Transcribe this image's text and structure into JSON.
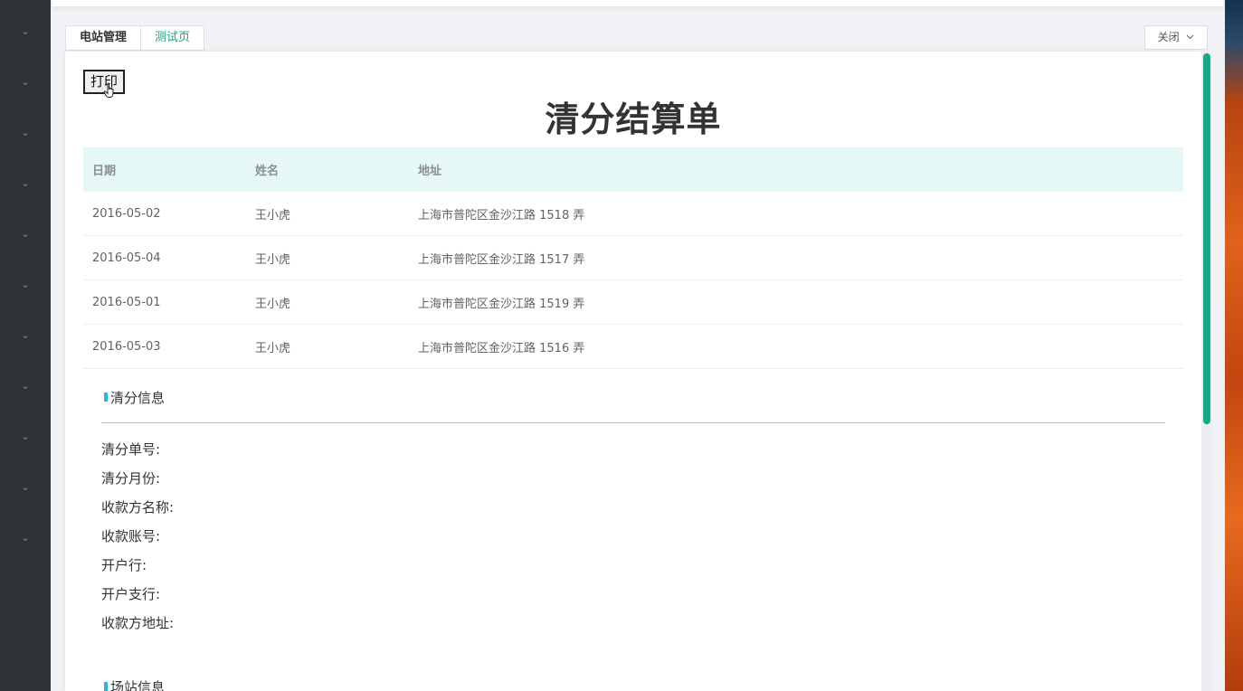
{
  "sidebar": {
    "chevron_glyph": "⌄",
    "items": [
      {
        "icon": "chevron-down-icon"
      },
      {
        "icon": "chevron-down-icon"
      },
      {
        "icon": "chevron-down-icon"
      },
      {
        "icon": "chevron-down-icon"
      },
      {
        "icon": "chevron-down-icon"
      },
      {
        "icon": "chevron-down-icon"
      },
      {
        "icon": "chevron-down-icon"
      },
      {
        "icon": "chevron-down-icon"
      },
      {
        "icon": "chevron-down-icon"
      },
      {
        "icon": "chevron-down-icon"
      },
      {
        "icon": "chevron-down-icon"
      }
    ]
  },
  "tabs": [
    {
      "label": "电站管理",
      "active": false
    },
    {
      "label": "测试页",
      "active": true
    }
  ],
  "close_button": {
    "label": "关闭",
    "icon": "chevron-down-icon"
  },
  "print_button": {
    "label": "打印"
  },
  "document": {
    "title": "清分结算单",
    "table": {
      "headers": [
        "日期",
        "姓名",
        "地址"
      ],
      "rows": [
        [
          "2016-05-02",
          "王小虎",
          "上海市普陀区金沙江路 1518 弄"
        ],
        [
          "2016-05-04",
          "王小虎",
          "上海市普陀区金沙江路 1517 弄"
        ],
        [
          "2016-05-01",
          "王小虎",
          "上海市普陀区金沙江路 1519 弄"
        ],
        [
          "2016-05-03",
          "王小虎",
          "上海市普陀区金沙江路 1516 弄"
        ]
      ]
    },
    "sections": [
      {
        "title": "清分信息",
        "fields": [
          "清分单号:",
          "清分月份:",
          "收款方名称:",
          "收款账号:",
          "开户行:",
          "开户支行:",
          "收款方地址:"
        ]
      },
      {
        "title": "场站信息",
        "fields": []
      }
    ]
  },
  "colors": {
    "accent": "#13a383",
    "table_header_bg": "#e6f8f5",
    "sidebar_bg": "#2f3336",
    "section_marker": "#2fb4d8"
  }
}
